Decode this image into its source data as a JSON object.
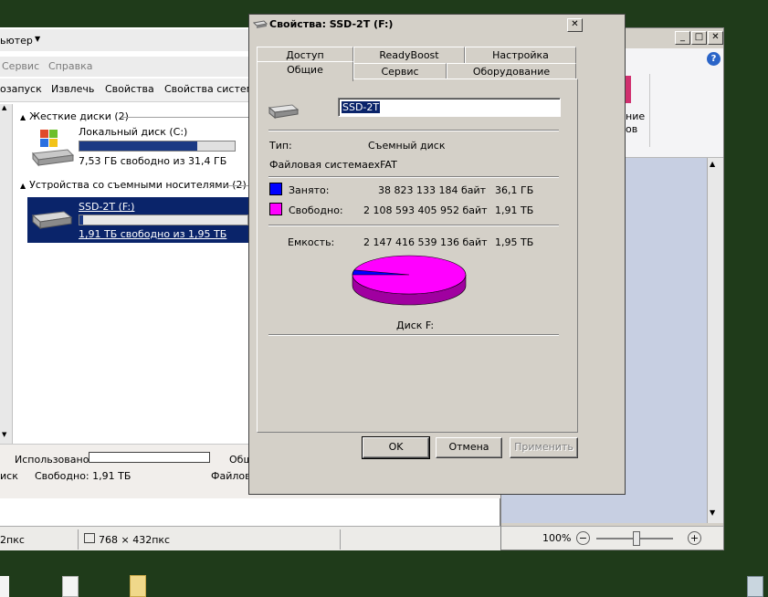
{
  "colors": {
    "used": "#0000ff",
    "free": "#ff00ff",
    "dialog_bg": "#d4d0c8",
    "selection": "#0a246a"
  },
  "explorer": {
    "address_fragment": "ьютер",
    "menu": [
      "Сервис",
      "Справка"
    ],
    "commands": [
      "озапуск",
      "Извлечь",
      "Свойства",
      "Свойства системы"
    ],
    "groups": [
      {
        "label": "Жесткие диски (2)",
        "items": [
          {
            "name": "Локальный диск (C:)",
            "space": "7,53 ГБ свободно из 31,4 ГБ",
            "used_fraction": 0.76
          }
        ]
      },
      {
        "label": "Устройства со съемными носителями (2)",
        "items": [
          {
            "name": "SSD-2T (F:)",
            "space": "1,91 ТБ свободно из 1,95 ТБ",
            "used_fraction": 0.02
          }
        ]
      }
    ],
    "details": {
      "used_label": "Использовано:",
      "total_fragment": "Общ",
      "free_prefix": "иск",
      "free": "Свободно: 1,91 ТБ",
      "fs": "Файловая система: exFAT"
    },
    "status": {
      "left": "2пкс",
      "size": "768 × 432пкс"
    }
  },
  "paint": {
    "ribbon_text1": "ние",
    "ribbon_text2": "ов",
    "zoom": "100%",
    "zoom_minus": "−",
    "zoom_plus": "+"
  },
  "dialog": {
    "title": "Свойства: SSD-2T (F:)",
    "tabs_back": [
      "Доступ",
      "ReadyBoost",
      "Настройка"
    ],
    "tabs_front": [
      "Общие",
      "Сервис",
      "Оборудование"
    ],
    "drive_name": "SSD-2T",
    "type_label": "Тип:",
    "type_value": "Съемный диск",
    "fs_label": "Файловая система:",
    "fs_value": "exFAT",
    "used_label": "Занято:",
    "used_bytes": "38 823 133 184 байт",
    "used_size": "36,1 ГБ",
    "free_label": "Свободно:",
    "free_bytes": "2 108 593 405 952 байт",
    "free_size": "1,91 ТБ",
    "capacity_label": "Емкость:",
    "capacity_bytes": "2 147 416 539 136 байт",
    "capacity_size": "1,95 ТБ",
    "disk_label": "Диск F:",
    "used_fraction": 0.0181,
    "ok": "OK",
    "cancel": "Отмена",
    "apply": "Применить"
  }
}
